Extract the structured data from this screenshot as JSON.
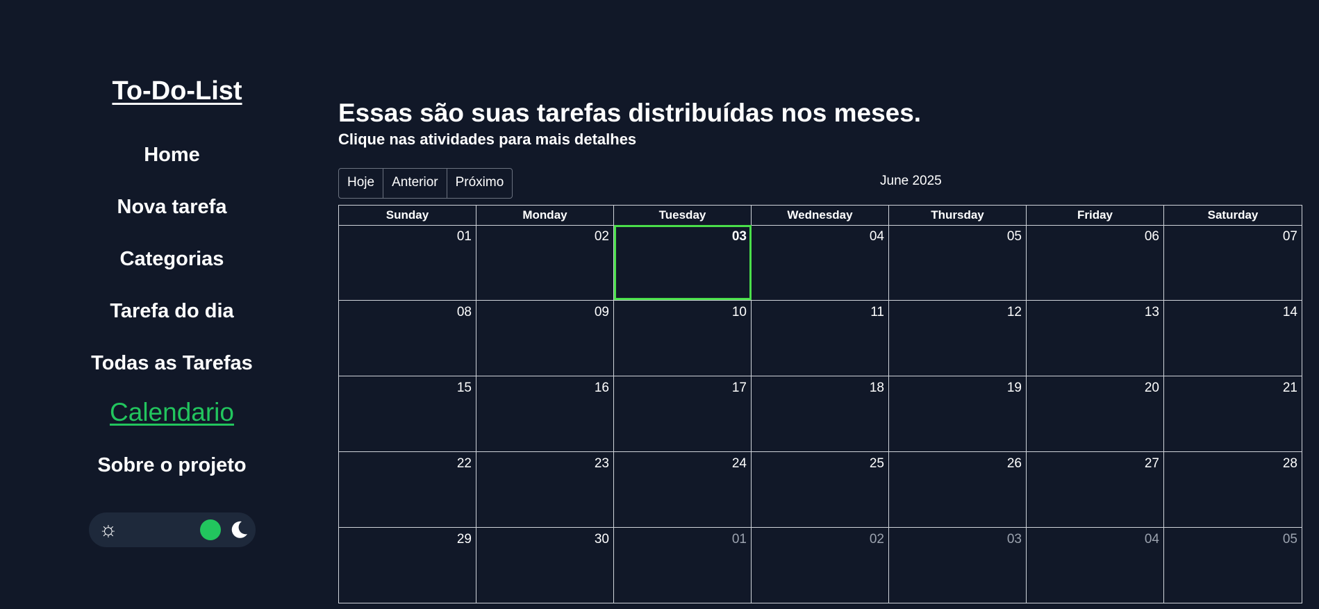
{
  "sidebar": {
    "brand": "To-Do-List",
    "nav": [
      {
        "label": "Home"
      },
      {
        "label": "Nova tarefa"
      },
      {
        "label": "Categorias"
      },
      {
        "label": "Tarefa do dia"
      },
      {
        "label": "Todas as Tarefas"
      },
      {
        "label": "Calendario",
        "active": true
      },
      {
        "label": "Sobre o projeto"
      }
    ],
    "theme_toggle": {
      "left_icon": "sun-icon",
      "right_icon": "moon-icon",
      "mode": "dark"
    }
  },
  "main": {
    "title": "Essas são suas tarefas distribuídas nos meses.",
    "subtitle": "Clique nas atividades para mais detalhes",
    "toolbar": {
      "today": "Hoje",
      "prev": "Anterior",
      "next": "Próximo"
    },
    "month_label": "June 2025"
  },
  "calendar": {
    "weekdays": [
      "Sunday",
      "Monday",
      "Tuesday",
      "Wednesday",
      "Thursday",
      "Friday",
      "Saturday"
    ],
    "weeks": [
      [
        "01",
        "02",
        "03",
        "04",
        "05",
        "06",
        "07"
      ],
      [
        "08",
        "09",
        "10",
        "11",
        "12",
        "13",
        "14"
      ],
      [
        "15",
        "16",
        "17",
        "18",
        "19",
        "20",
        "21"
      ],
      [
        "22",
        "23",
        "24",
        "25",
        "26",
        "27",
        "28"
      ],
      [
        "29",
        "30",
        "01",
        "02",
        "03",
        "04",
        "05"
      ]
    ],
    "today": "03",
    "other_month_days": [
      "01",
      "02",
      "03",
      "04",
      "05"
    ]
  },
  "colors": {
    "background": "#111828",
    "accent": "#22c55e",
    "today_border": "#4ade4a",
    "grid": "#d1d5db",
    "muted_text": "#9ca3af"
  }
}
